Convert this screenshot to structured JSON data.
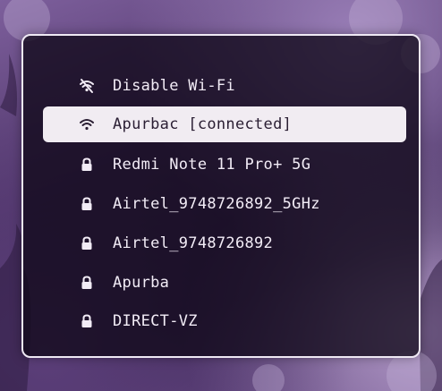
{
  "menu": {
    "items": [
      {
        "label": "Disable Wi-Fi",
        "icon": "wifi-off-icon",
        "selected": false
      },
      {
        "label": "Apurbac [connected]",
        "icon": "wifi-icon",
        "selected": true
      },
      {
        "label": "Redmi Note 11 Pro+ 5G",
        "icon": "lock-icon",
        "selected": false
      },
      {
        "label": "Airtel_9748726892_5GHz",
        "icon": "lock-icon",
        "selected": false
      },
      {
        "label": "Airtel_9748726892",
        "icon": "lock-icon",
        "selected": false
      },
      {
        "label": "Apurba",
        "icon": "lock-icon",
        "selected": false
      },
      {
        "label": "DIRECT-VZ",
        "icon": "lock-icon",
        "selected": false
      }
    ]
  },
  "colors": {
    "menu_background": "#100818",
    "menu_border": "#efe9f4",
    "selected_background": "#f1ecf2",
    "selected_text": "#2a1e33",
    "text": "#f2ecf6"
  }
}
